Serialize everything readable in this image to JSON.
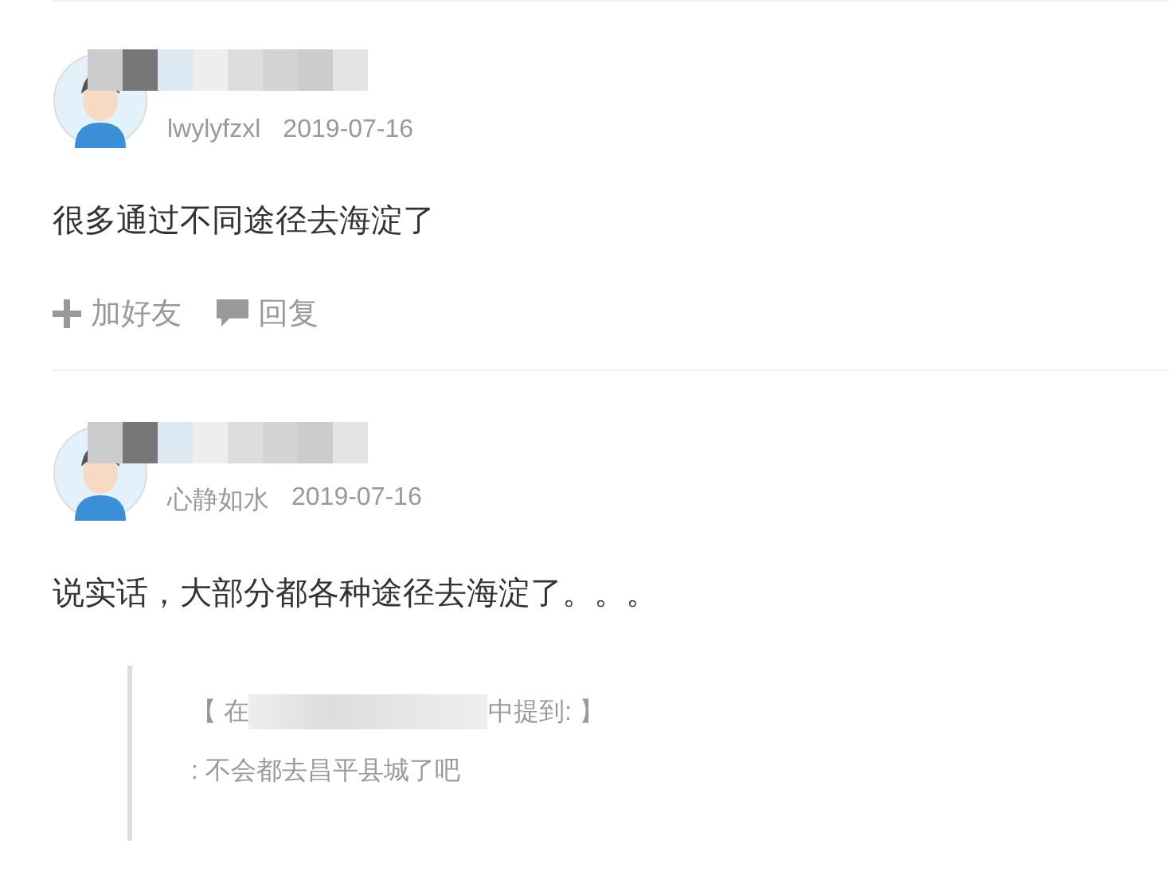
{
  "comments": [
    {
      "author": "lwylyfzxl",
      "date": "2019-07-16",
      "text": "很多通过不同途径去海淀了",
      "actions": [
        {
          "kind": "add-friend",
          "label": "加好友"
        },
        {
          "kind": "reply",
          "label": "回复"
        }
      ]
    },
    {
      "author": "心静如水",
      "date": "2019-07-16",
      "text": "说实话，大部分都各种途径去海淀了。。。",
      "quote": {
        "prefix": "【 在",
        "suffix": "中提到: 】",
        "text": ": 不会都去昌平县城了吧"
      }
    }
  ]
}
